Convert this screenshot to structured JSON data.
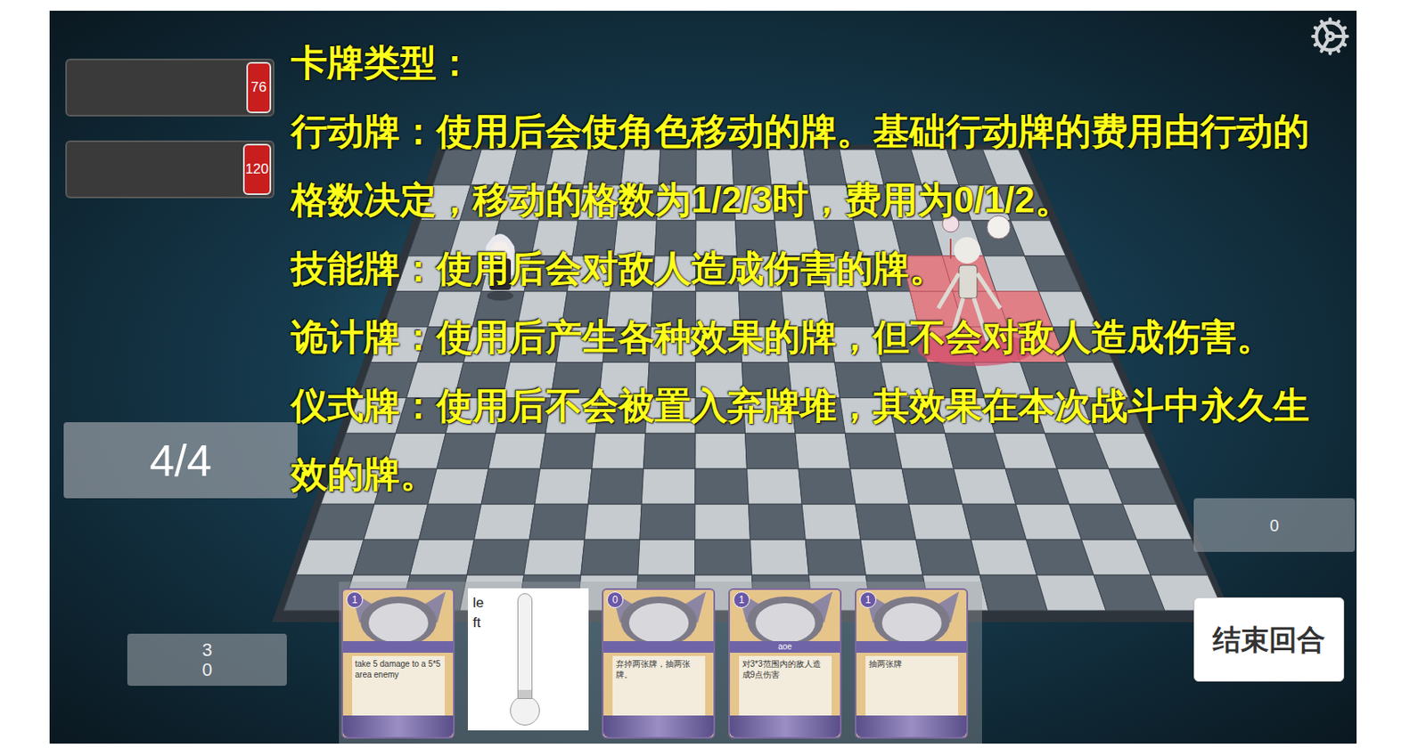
{
  "hud": {
    "bars": [
      {
        "value": "76"
      },
      {
        "value": "120"
      }
    ],
    "energy": "4/4",
    "deck": {
      "draw": "3",
      "discard": "0"
    },
    "counter": "0",
    "end_turn": "结束回合"
  },
  "overlay": {
    "title": "卡牌类型：",
    "lines": [
      "行动牌：使用后会使角色移动的牌。基础行动牌的费用由行动的格数决定，移动的格数为1/2/3时，费用为0/1/2。",
      "技能牌：使用后会对敌人造成伤害的牌。",
      "诡计牌：使用后产生各种效果的牌，但不会对敌人造成伤害。",
      "仪式牌：使用后不会被置入弃牌堆，其效果在本次战斗中永久生效的牌。"
    ]
  },
  "board": {
    "cols": 16,
    "rows": 13,
    "highlighted": [
      [
        3,
        12
      ],
      [
        3,
        13
      ],
      [
        4,
        12
      ],
      [
        4,
        13
      ],
      [
        4,
        14
      ],
      [
        5,
        12
      ],
      [
        5,
        13
      ],
      [
        5,
        14
      ]
    ]
  },
  "hand": [
    {
      "kind": "card",
      "cost": "1",
      "title": "",
      "text": "take 5 damage to a 5*5 area enemy"
    },
    {
      "kind": "slider",
      "label": "left",
      "level": 0.08
    },
    {
      "kind": "card",
      "cost": "0",
      "title": "",
      "text": "弃掉两张牌，抽两张牌。"
    },
    {
      "kind": "card",
      "cost": "1",
      "title": "aoe",
      "text": "对3*3范围内的敌人造成9点伤害"
    },
    {
      "kind": "card",
      "cost": "1",
      "title": "",
      "text": "抽两张牌"
    }
  ]
}
